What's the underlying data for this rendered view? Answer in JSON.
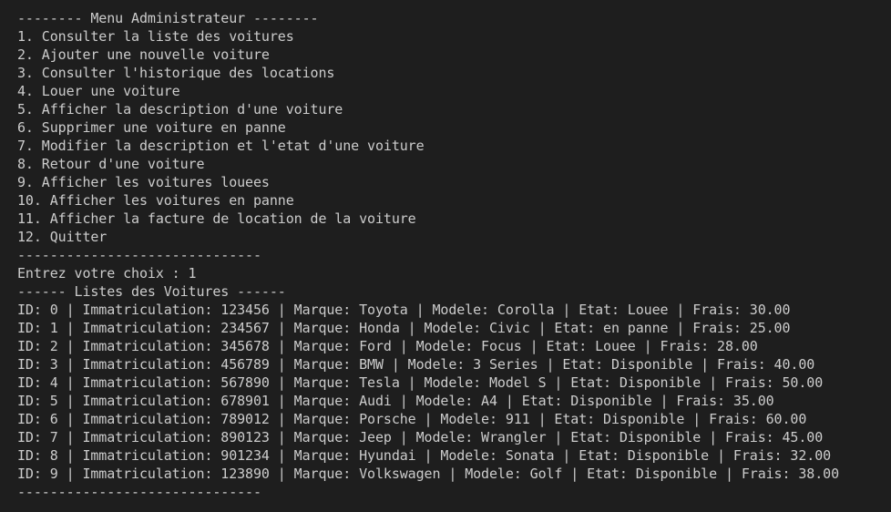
{
  "terminal": {
    "menu_header": "-------- Menu Administrateur --------",
    "menu_items": [
      "1. Consulter la liste des voitures",
      "2. Ajouter une nouvelle voiture",
      "3. Consulter l'historique des locations",
      "4. Louer une voiture",
      "5. Afficher la description d'une voiture",
      "6. Supprimer une voiture en panne",
      "7. Modifier la description et l'etat d'une voiture",
      "8. Retour d'une voiture",
      "9. Afficher les voitures louees",
      "10. Afficher les voitures en panne",
      "11. Afficher la facture de location de la voiture",
      "12. Quitter"
    ],
    "separator_1": "------------------------------",
    "prompt": "Entrez votre choix : ",
    "choice": "1",
    "list_header": "------ Listes des Voitures ------",
    "cars": [
      "ID: 0 | Immatriculation: 123456 | Marque: Toyota | Modele: Corolla | Etat: Louee | Frais: 30.00",
      "ID: 1 | Immatriculation: 234567 | Marque: Honda | Modele: Civic | Etat: en panne | Frais: 25.00",
      "ID: 2 | Immatriculation: 345678 | Marque: Ford | Modele: Focus | Etat: Louee | Frais: 28.00",
      "ID: 3 | Immatriculation: 456789 | Marque: BMW | Modele: 3 Series | Etat: Disponible | Frais: 40.00",
      "ID: 4 | Immatriculation: 567890 | Marque: Tesla | Modele: Model S | Etat: Disponible | Frais: 50.00",
      "ID: 5 | Immatriculation: 678901 | Marque: Audi | Modele: A4 | Etat: Disponible | Frais: 35.00",
      "ID: 6 | Immatriculation: 789012 | Marque: Porsche | Modele: 911 | Etat: Disponible | Frais: 60.00",
      "ID: 7 | Immatriculation: 890123 | Marque: Jeep | Modele: Wrangler | Etat: Disponible | Frais: 45.00",
      "ID: 8 | Immatriculation: 901234 | Marque: Hyundai | Modele: Sonata | Etat: Disponible | Frais: 32.00",
      "ID: 9 | Immatriculation: 123890 | Marque: Volkswagen | Modele: Golf | Etat: Disponible | Frais: 38.00"
    ],
    "separator_2": "------------------------------",
    "colors": {
      "background": "#1e1e1e",
      "text": "#cccccc"
    }
  }
}
